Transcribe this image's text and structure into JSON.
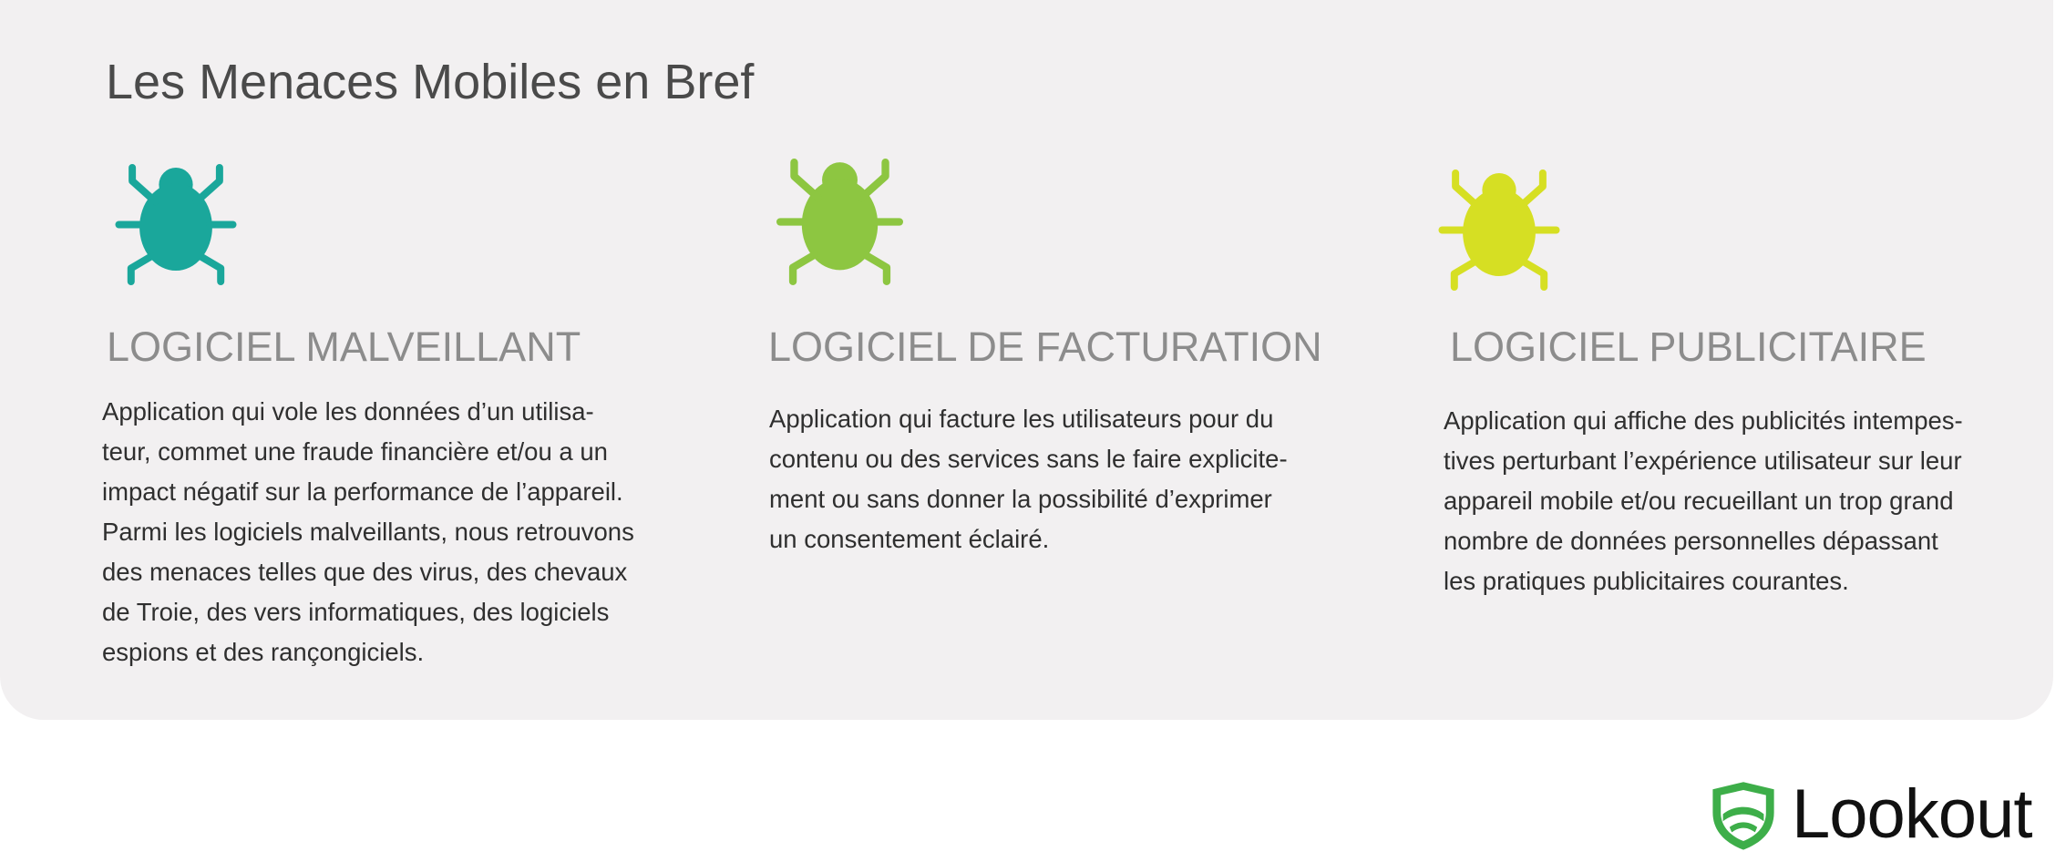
{
  "title": "Les Menaces Mobiles en Bref",
  "colors": {
    "panel_background": "#f2f0f1",
    "malware": "#1aa79b",
    "billing": "#8dc641",
    "adware": "#d6df23",
    "heading": "#8c8c8c",
    "logo_shield": "#3dae49"
  },
  "columns": [
    {
      "icon": "bug-icon",
      "heading": "LOGICIEL MALVEILLANT",
      "description_lines": [
        "Application qui vole les données d’un utilisa-",
        "teur, commet une fraude financière et/ou a un",
        "impact négatif sur la performance de l’appareil.",
        "Parmi les logiciels malveillants, nous retrouvons",
        "des menaces telles que des virus, des chevaux",
        "de Troie, des vers informatiques, des logiciels",
        "espions et des rançongiciels."
      ]
    },
    {
      "icon": "bug-icon",
      "heading": "LOGICIEL DE FACTURATION",
      "description_lines": [
        "Application qui facture les utilisateurs pour du",
        "contenu ou des services sans le faire explicite-",
        "ment ou sans donner la possibilité d’exprimer",
        "un consentement éclairé."
      ]
    },
    {
      "icon": "bug-icon",
      "heading": "LOGICIEL PUBLICITAIRE",
      "description_lines": [
        "Application qui affiche des publicités intempes-",
        "tives perturbant l’expérience utilisateur sur leur",
        "appareil mobile et/ou recueillant un trop grand",
        "nombre de données personnelles dépassant",
        "les pratiques publicitaires courantes."
      ]
    }
  ],
  "logo": {
    "icon": "shield-icon",
    "text": "Lookout"
  }
}
